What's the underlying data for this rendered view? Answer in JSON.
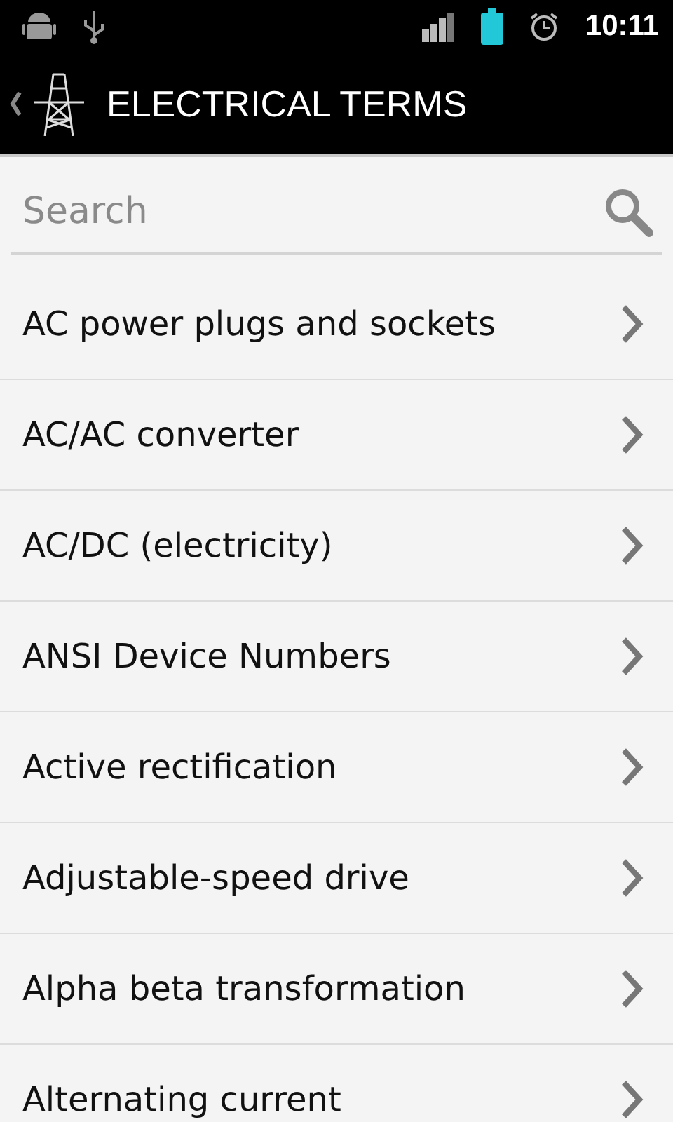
{
  "status_bar": {
    "time": "10:11"
  },
  "action_bar": {
    "title": "ELECTRICAL TERMS"
  },
  "search": {
    "placeholder": "Search"
  },
  "items": [
    {
      "label": "AC power plugs and sockets"
    },
    {
      "label": "AC/AC converter"
    },
    {
      "label": "AC/DC (electricity)"
    },
    {
      "label": "ANSI Device Numbers"
    },
    {
      "label": "Active rectification"
    },
    {
      "label": "Adjustable-speed drive"
    },
    {
      "label": "Alpha beta transformation"
    },
    {
      "label": "Alternating current"
    }
  ]
}
